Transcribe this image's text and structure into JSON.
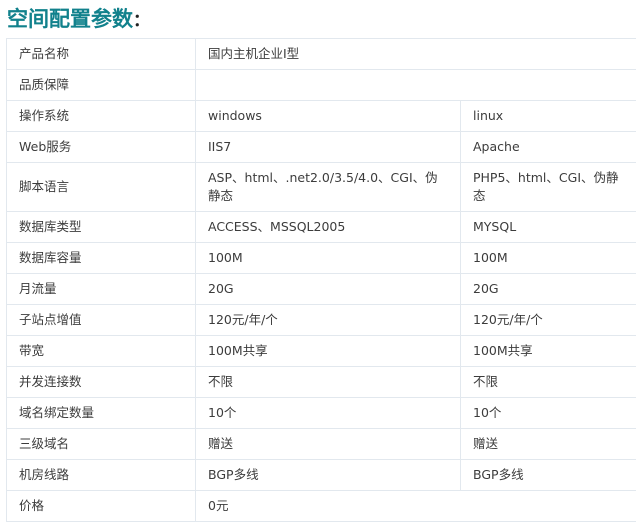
{
  "section": {
    "title": "空间配置参数",
    "title_colon": "：",
    "title_color": "#11818c"
  },
  "table": {
    "border_color": "#e2e8ee",
    "text_color": "#3c3c3c",
    "rows": [
      {
        "label": "产品名称",
        "span": true,
        "value": "国内主机企业I型"
      },
      {
        "label": "品质保障",
        "span": true,
        "value": ""
      },
      {
        "label": "操作系统",
        "span": false,
        "windows": "windows",
        "linux": "linux"
      },
      {
        "label": "Web服务",
        "span": false,
        "windows": "IIS7",
        "linux": "Apache"
      },
      {
        "label": "脚本语言",
        "span": false,
        "tall": true,
        "windows": "ASP、html、.net2.0/3.5/4.0、CGI、伪静态",
        "linux": "PHP5、html、CGI、伪静态"
      },
      {
        "label": "数据库类型",
        "span": false,
        "windows": "ACCESS、MSSQL2005",
        "linux": "MYSQL"
      },
      {
        "label": "数据库容量",
        "span": false,
        "windows": "100M",
        "linux": "100M"
      },
      {
        "label": "月流量",
        "span": false,
        "windows": "20G",
        "linux": "20G"
      },
      {
        "label": "子站点增值",
        "span": false,
        "windows": "120元/年/个",
        "linux": "120元/年/个"
      },
      {
        "label": "带宽",
        "span": false,
        "windows": "100M共享",
        "linux": "100M共享"
      },
      {
        "label": "并发连接数",
        "span": false,
        "windows": "不限",
        "linux": "不限"
      },
      {
        "label": "域名绑定数量",
        "span": false,
        "windows": "10个",
        "linux": "10个"
      },
      {
        "label": "三级域名",
        "span": false,
        "windows": "赠送",
        "linux": "赠送"
      },
      {
        "label": "机房线路",
        "span": false,
        "windows": "BGP多线",
        "linux": "BGP多线"
      },
      {
        "label": "价格",
        "span": true,
        "value": "0元"
      }
    ]
  }
}
